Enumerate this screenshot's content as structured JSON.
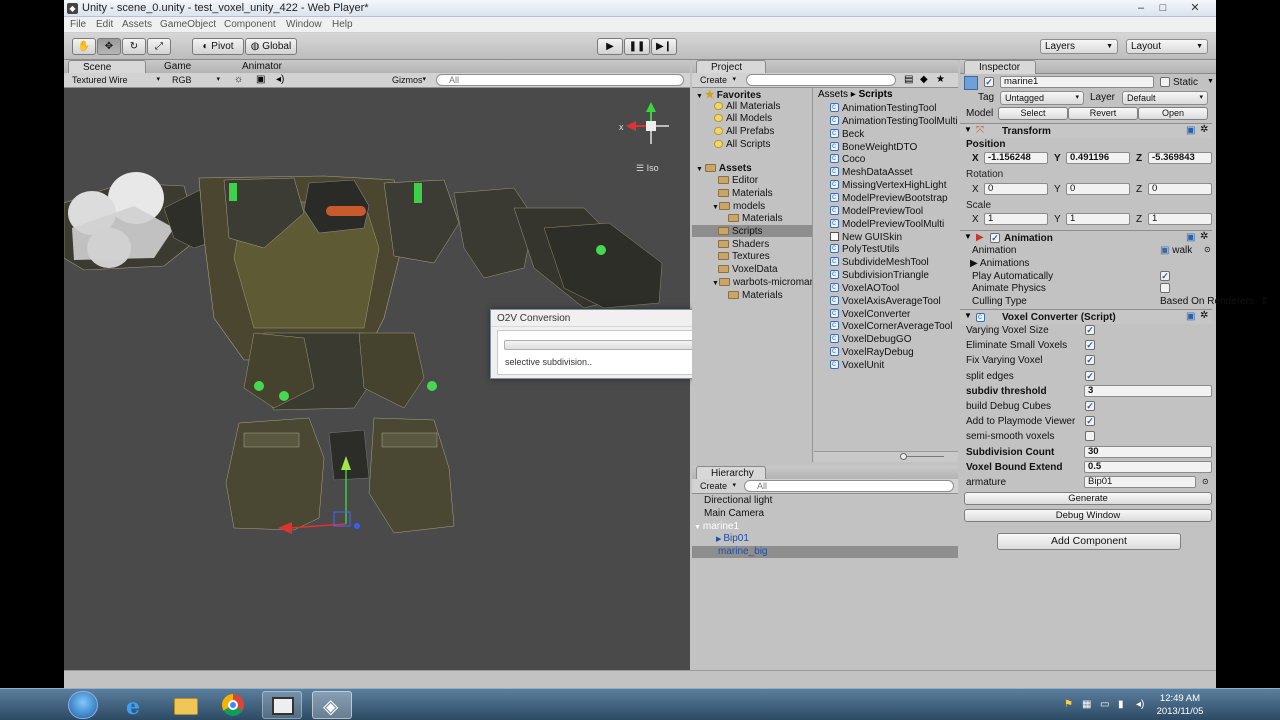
{
  "window": {
    "title": "Unity - scene_0.unity - test_voxel_unity_422 - Web Player*",
    "controls": [
      "–",
      "□",
      "✕"
    ]
  },
  "menu": [
    "File",
    "Edit",
    "Assets",
    "GameObject",
    "Component",
    "Window",
    "Help"
  ],
  "toolbar": {
    "pivot_label": "Pivot",
    "global_label": "Global",
    "layers_label": "Layers",
    "layout_label": "Layout"
  },
  "scene": {
    "tabs": [
      "Scene",
      "Game",
      "Animator"
    ],
    "render_mode": "Textured Wire",
    "color_mode": "RGB",
    "gizmos_label": "Gizmos",
    "search_placeholder": "All",
    "iso_label": "Iso",
    "gizmo_x": "x"
  },
  "project": {
    "tab": "Project",
    "create_label": "Create",
    "favorites_label": "Favorites",
    "favorites": [
      "All Materials",
      "All Models",
      "All Prefabs",
      "All Scripts"
    ],
    "assets_label": "Assets",
    "folders": [
      {
        "name": "Editor",
        "indent": 1
      },
      {
        "name": "Materials",
        "indent": 1
      },
      {
        "name": "models",
        "indent": 1
      },
      {
        "name": "Materials",
        "indent": 2
      },
      {
        "name": "Scripts",
        "indent": 1
      },
      {
        "name": "Shaders",
        "indent": 1
      },
      {
        "name": "Textures",
        "indent": 1
      },
      {
        "name": "VoxelData",
        "indent": 1
      },
      {
        "name": "warbots-microman",
        "indent": 1
      },
      {
        "name": "Materials",
        "indent": 2
      }
    ],
    "selected_folder": "Scripts",
    "breadcrumb_root": "Assets",
    "breadcrumb_sep": "▸",
    "breadcrumb_current": "Scripts",
    "files": [
      {
        "name": "AnimationTestingTool",
        "kind": "script"
      },
      {
        "name": "AnimationTestingToolMulti",
        "kind": "script"
      },
      {
        "name": "Beck",
        "kind": "script"
      },
      {
        "name": "BoneWeightDTO",
        "kind": "script"
      },
      {
        "name": "Coco",
        "kind": "script"
      },
      {
        "name": "MeshDataAsset",
        "kind": "script"
      },
      {
        "name": "MissingVertexHighLight",
        "kind": "script"
      },
      {
        "name": "ModelPreviewBootstrap",
        "kind": "script"
      },
      {
        "name": "ModelPreviewTool",
        "kind": "script"
      },
      {
        "name": "ModelPreviewToolMulti",
        "kind": "script"
      },
      {
        "name": "New GUISkin",
        "kind": "guiskin"
      },
      {
        "name": "PolyTestUtils",
        "kind": "script"
      },
      {
        "name": "SubdivideMeshTool",
        "kind": "script"
      },
      {
        "name": "SubdivisionTriangle",
        "kind": "script"
      },
      {
        "name": "VoxelAOTool",
        "kind": "script"
      },
      {
        "name": "VoxelAxisAverageTool",
        "kind": "script"
      },
      {
        "name": "VoxelConverter",
        "kind": "script"
      },
      {
        "name": "VoxelCornerAverageTool",
        "kind": "script"
      },
      {
        "name": "VoxelDebugGO",
        "kind": "script"
      },
      {
        "name": "VoxelRayDebug",
        "kind": "script"
      },
      {
        "name": "VoxelUnit",
        "kind": "script"
      }
    ]
  },
  "hierarchy": {
    "tab": "Hierarchy",
    "create_label": "Create",
    "search_placeholder": "All",
    "items": [
      {
        "name": "Directional light",
        "indent": 0,
        "selected": false
      },
      {
        "name": "Main Camera",
        "indent": 0,
        "selected": false
      },
      {
        "name": "marine1",
        "indent": 0,
        "selected": true
      },
      {
        "name": "Bip01",
        "indent": 1,
        "selected": false
      },
      {
        "name": "marine_big",
        "indent": 1,
        "selected": false
      }
    ]
  },
  "inspector": {
    "tab": "Inspector",
    "object_name": "marine1",
    "static_label": "Static",
    "tag_label": "Tag",
    "tag_value": "Untagged",
    "layer_label": "Layer",
    "layer_value": "Default",
    "model_label": "Model",
    "model_buttons": [
      "Select",
      "Revert",
      "Open"
    ],
    "transform": {
      "title": "Transform",
      "position_label": "Position",
      "rotation_label": "Rotation",
      "scale_label": "Scale",
      "axes": [
        "X",
        "Y",
        "Z"
      ],
      "position": [
        "-1.156248",
        "0.491196",
        "-5.369843"
      ],
      "rotation": [
        "0",
        "0",
        "0"
      ],
      "scale": [
        "1",
        "1",
        "1"
      ]
    },
    "animation": {
      "title": "Animation",
      "rows": [
        {
          "label": "Animation",
          "value": "walk"
        },
        {
          "label": "Animations",
          "value": ""
        },
        {
          "label": "Play Automatically",
          "value": "check"
        },
        {
          "label": "Animate Physics",
          "value": "uncheck"
        },
        {
          "label": "Culling Type",
          "value": "Based On Renderers"
        }
      ]
    },
    "voxel_converter": {
      "title": "Voxel Converter (Script)",
      "rows": [
        {
          "label": "Varying Voxel Size",
          "type": "check",
          "value": true,
          "bold": false
        },
        {
          "label": "Eliminate Small Voxels",
          "type": "check",
          "value": true,
          "bold": false
        },
        {
          "label": "Fix Varying Voxel",
          "type": "check",
          "value": true,
          "bold": false
        },
        {
          "label": "split edges",
          "type": "check",
          "value": true,
          "bold": false
        },
        {
          "label": "subdiv threshold",
          "type": "field",
          "value": "3",
          "bold": true
        },
        {
          "label": "build Debug Cubes",
          "type": "check",
          "value": true,
          "bold": false
        },
        {
          "label": "Add to Playmode Viewer",
          "type": "check",
          "value": true,
          "bold": false
        },
        {
          "label": "semi-smooth voxels",
          "type": "check",
          "value": false,
          "bold": false
        },
        {
          "label": "Subdivision Count",
          "type": "field",
          "value": "30",
          "bold": true
        },
        {
          "label": "Voxel Bound Extend",
          "type": "field",
          "value": "0.5",
          "bold": true
        },
        {
          "label": "armature",
          "type": "object",
          "value": "Bip01",
          "bold": false
        }
      ],
      "generate_label": "Generate",
      "debug_window_label": "Debug Window"
    },
    "add_component_label": "Add Component"
  },
  "dialog": {
    "title": "O2V Conversion",
    "status": "selective subdivision..",
    "progress": 0.0
  },
  "taskbar": {
    "time": "12:49 AM",
    "date": "2013/11/05",
    "apps": [
      "start-orb",
      "internet-explorer",
      "file-explorer",
      "chrome",
      "window-app",
      "unity"
    ]
  },
  "colors": {
    "unity_bg": "#c2c2c2",
    "scene_bg": "#4a4a4a",
    "selection": "#8e8e8e",
    "link_blue": "#1f4ea8"
  }
}
